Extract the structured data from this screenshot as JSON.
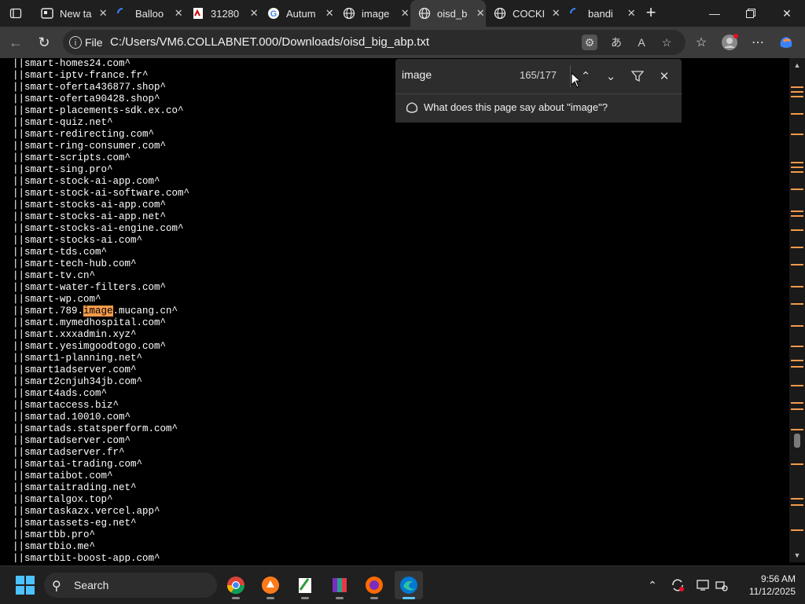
{
  "tabs": [
    {
      "title": "New ta",
      "icon": "new-tab-icon",
      "active": false
    },
    {
      "title": "Balloo",
      "icon": "loading-spinner-icon",
      "active": false
    },
    {
      "title": "31280",
      "icon": "document-icon",
      "active": false
    },
    {
      "title": "Autum",
      "icon": "google-icon",
      "active": false
    },
    {
      "title": "image",
      "icon": "globe-icon",
      "active": false
    },
    {
      "title": "oisd_b",
      "icon": "globe-icon",
      "active": true
    },
    {
      "title": "COCKI",
      "icon": "globe-icon",
      "active": false
    },
    {
      "title": "bandi",
      "icon": "loading-spinner-icon",
      "active": false
    }
  ],
  "address": {
    "label": "File",
    "url": "C:/Users/VM6.COLLABNET.000/Downloads/oisd_big_abp.txt"
  },
  "find": {
    "query": "image",
    "count": "165/177",
    "prompt": "What does this page say about \"image\"?"
  },
  "content_lines": [
    "||smart-homes24.com^",
    "||smart-iptv-france.fr^",
    "||smart-oferta436877.shop^",
    "||smart-oferta90428.shop^",
    "||smart-placements-sdk.ex.co^",
    "||smart-quiz.net^",
    "||smart-redirecting.com^",
    "||smart-ring-consumer.com^",
    "||smart-scripts.com^",
    "||smart-sing.pro^",
    "||smart-stock-ai-app.com^",
    "||smart-stock-ai-software.com^",
    "||smart-stocks-ai-app.com^",
    "||smart-stocks-ai-app.net^",
    "||smart-stocks-ai-engine.com^",
    "||smart-stocks-ai.com^",
    "||smart-tds.com^",
    "||smart-tech-hub.com^",
    "||smart-tv.cn^",
    "||smart-water-filters.com^",
    "||smart-wp.com^",
    "||smart.789.image.mucang.cn^",
    "||smart.mymedhospital.com^",
    "||smart.xxxadmin.xyz^",
    "||smart.yesimgoodtogo.com^",
    "||smart1-planning.net^",
    "||smart1adserver.com^",
    "||smart2cnjuh34jb.com^",
    "||smart4ads.com^",
    "||smartaccess.biz^",
    "||smartad.10010.com^",
    "||smartads.statsperform.com^",
    "||smartadserver.com^",
    "||smartadserver.fr^",
    "||smartai-trading.com^",
    "||smartaibot.com^",
    "||smartaitrading.net^",
    "||smartalgox.top^",
    "||smartaskazx.vercel.app^",
    "||smartassets-eg.net^",
    "||smartbb.pro^",
    "||smartbio.me^",
    "||smartbit-boost-app.com^"
  ],
  "highlight": {
    "line_index": 21,
    "before": "||smart.789.",
    "match": "image",
    "after": ".mucang.cn^"
  },
  "taskbar": {
    "search_label": "Search",
    "time": "9:56 AM",
    "date": "11/12/2025"
  },
  "colors": {
    "highlight": "#f59a4a",
    "accent": "#4cc2ff"
  }
}
